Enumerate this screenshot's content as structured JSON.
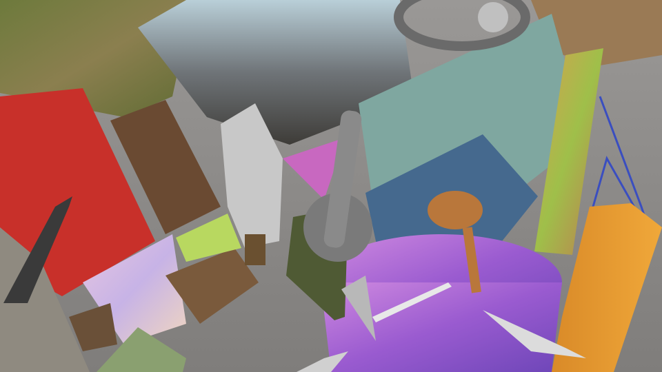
{
  "scene": {
    "colors": {
      "floor": "#8f8d8b",
      "grass": "#7a7a45",
      "red_block": "#c8302a",
      "teal_panel": "#7fa7a0",
      "blue_panel": "#45698e",
      "orange_block": "#e89a30",
      "guitar": "#b9773b",
      "camo": "#4f5a34",
      "purple_disc": "#a66ad0",
      "headphones": "#8a8a8a",
      "keyboard": "#b9a95a"
    }
  }
}
